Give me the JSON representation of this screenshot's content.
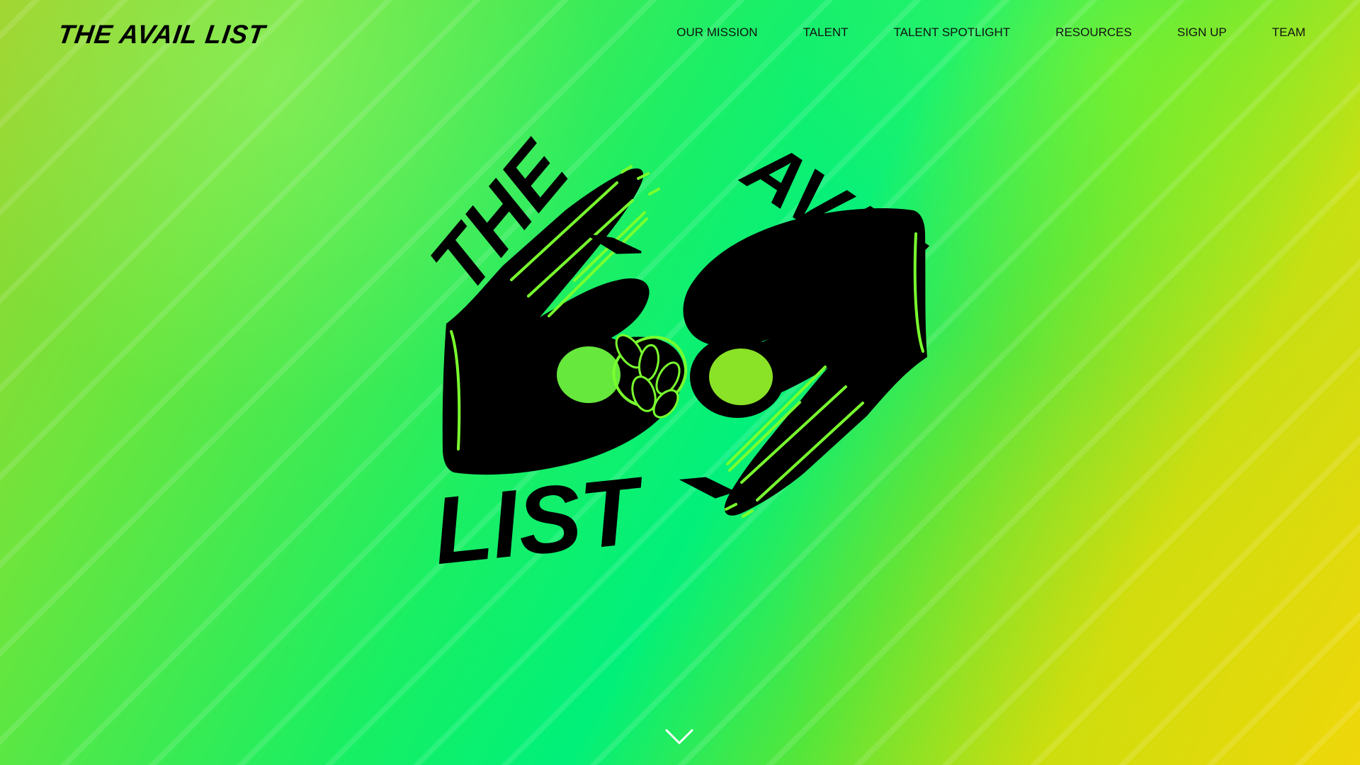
{
  "header": {
    "brand": "THE AVAIL LIST",
    "nav": [
      {
        "label": "OUR MISSION"
      },
      {
        "label": "TALENT"
      },
      {
        "label": "TALENT SPOTLIGHT"
      },
      {
        "label": "RESOURCES"
      },
      {
        "label": "SIGN UP"
      },
      {
        "label": "TEAM"
      }
    ]
  },
  "hero": {
    "logo_words": {
      "top_left": "THE",
      "top_right": "AVAIL",
      "bottom_left": "LIST"
    }
  },
  "icons": {
    "scroll": "chevron-down-icon"
  },
  "colors": {
    "text": "#000000",
    "nav_text": "#121212",
    "accent_green": "#00f07a",
    "accent_yellow": "#eed70a",
    "logo_stroke": "#7cff2f"
  }
}
